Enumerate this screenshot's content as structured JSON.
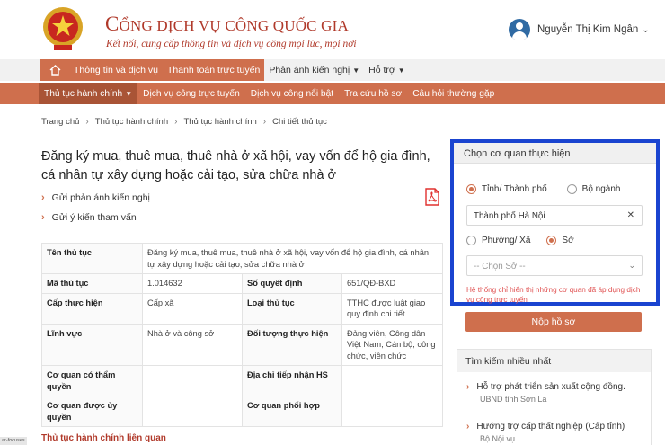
{
  "header": {
    "site_title_big": "C",
    "site_title_rest": "ỔNG DỊCH VỤ CÔNG QUỐC GIA",
    "site_subtitle": "Kết nối, cung cấp thông tin và dịch vụ công mọi lúc, mọi nơi",
    "user_name": "Nguyễn Thị Kim Ngân"
  },
  "nav_top": {
    "items": [
      {
        "label": "Thông tin và dịch vụ"
      },
      {
        "label": "Thanh toán trực tuyến"
      },
      {
        "label": "Phản ánh kiến nghị"
      },
      {
        "label": "Hỗ trợ"
      }
    ]
  },
  "nav_sub": {
    "items": [
      {
        "label": "Thủ tục hành chính"
      },
      {
        "label": "Dịch vụ công trực tuyến"
      },
      {
        "label": "Dịch vụ công nổi bật"
      },
      {
        "label": "Tra cứu hồ sơ"
      },
      {
        "label": "Câu hỏi thường gặp"
      }
    ]
  },
  "breadcrumb": [
    "Trang chủ",
    "Thủ tục hành chính",
    "Thủ tục hành chính",
    "Chi tiết thủ tục"
  ],
  "procedure": {
    "title": "Đăng ký mua, thuê mua, thuê nhà ở xã hội, vay vốn để hộ gia đình, cá nhân tự xây dựng hoặc cải tạo, sửa chữa nhà ở",
    "links": [
      "Gửi phản ánh kiến nghị",
      "Gửi ý kiến tham vấn"
    ]
  },
  "info_table": {
    "name_label": "Tên thủ tục",
    "name_value": "Đăng ký mua, thuê mua, thuê nhà ở xã hội, vay vốn để hộ gia đình, cá nhân tự xây dựng hoặc cải tạo, sửa chữa nhà ở",
    "rows": [
      {
        "l1": "Mã thủ tục",
        "v1": "1.014632",
        "l2": "Số quyết định",
        "v2": "651/QĐ-BXD"
      },
      {
        "l1": "Cấp thực hiện",
        "v1": "Cấp xã",
        "l2": "Loại thủ tục",
        "v2": "TTHC được luật giao quy định chi tiết"
      },
      {
        "l1": "Lĩnh vực",
        "v1": "Nhà ở và công sở",
        "l2": "Đối tượng thực hiện",
        "v2": "Đảng viên, Công dân Việt Nam, Cán bộ, công chức, viên chức"
      },
      {
        "l1": "Cơ quan có thẩm quyền",
        "v1": "",
        "l2": "Địa chỉ tiếp nhận HS",
        "v2": ""
      },
      {
        "l1": "Cơ quan được ủy quyền",
        "v1": "",
        "l2": "Cơ quan phối hợp",
        "v2": ""
      }
    ]
  },
  "related_heading": "Thủ tục hành chính liên quan",
  "agency_panel": {
    "heading": "Chọn cơ quan thực hiện",
    "radio_province": "Tỉnh/ Thành phố",
    "radio_ministry": "Bộ ngành",
    "province_value": "Thành phố Hà Nội",
    "radio_ward": "Phường/ Xã",
    "radio_department": "Sở",
    "department_placeholder": "-- Chọn Sở --",
    "note": "Hệ thống chỉ hiển thị những cơ quan đã áp dụng dịch vụ công trực tuyến"
  },
  "submit_label": "Nộp hồ sơ",
  "search_panel": {
    "heading": "Tìm kiếm nhiều nhất",
    "items": [
      {
        "title": "Hỗ trợ phát triển sản xuất cộng đồng.",
        "org": "UBND tỉnh Sơn La"
      },
      {
        "title": "Hướng trợ cấp thất nghiệp (Cấp tỉnh)",
        "org": "Bộ Nội vụ"
      }
    ]
  },
  "corner_tag": "ar-focuses",
  "colors": {
    "accent": "#cf6f4d",
    "brand": "#b0392a",
    "highlight_border": "#1a44d0"
  }
}
